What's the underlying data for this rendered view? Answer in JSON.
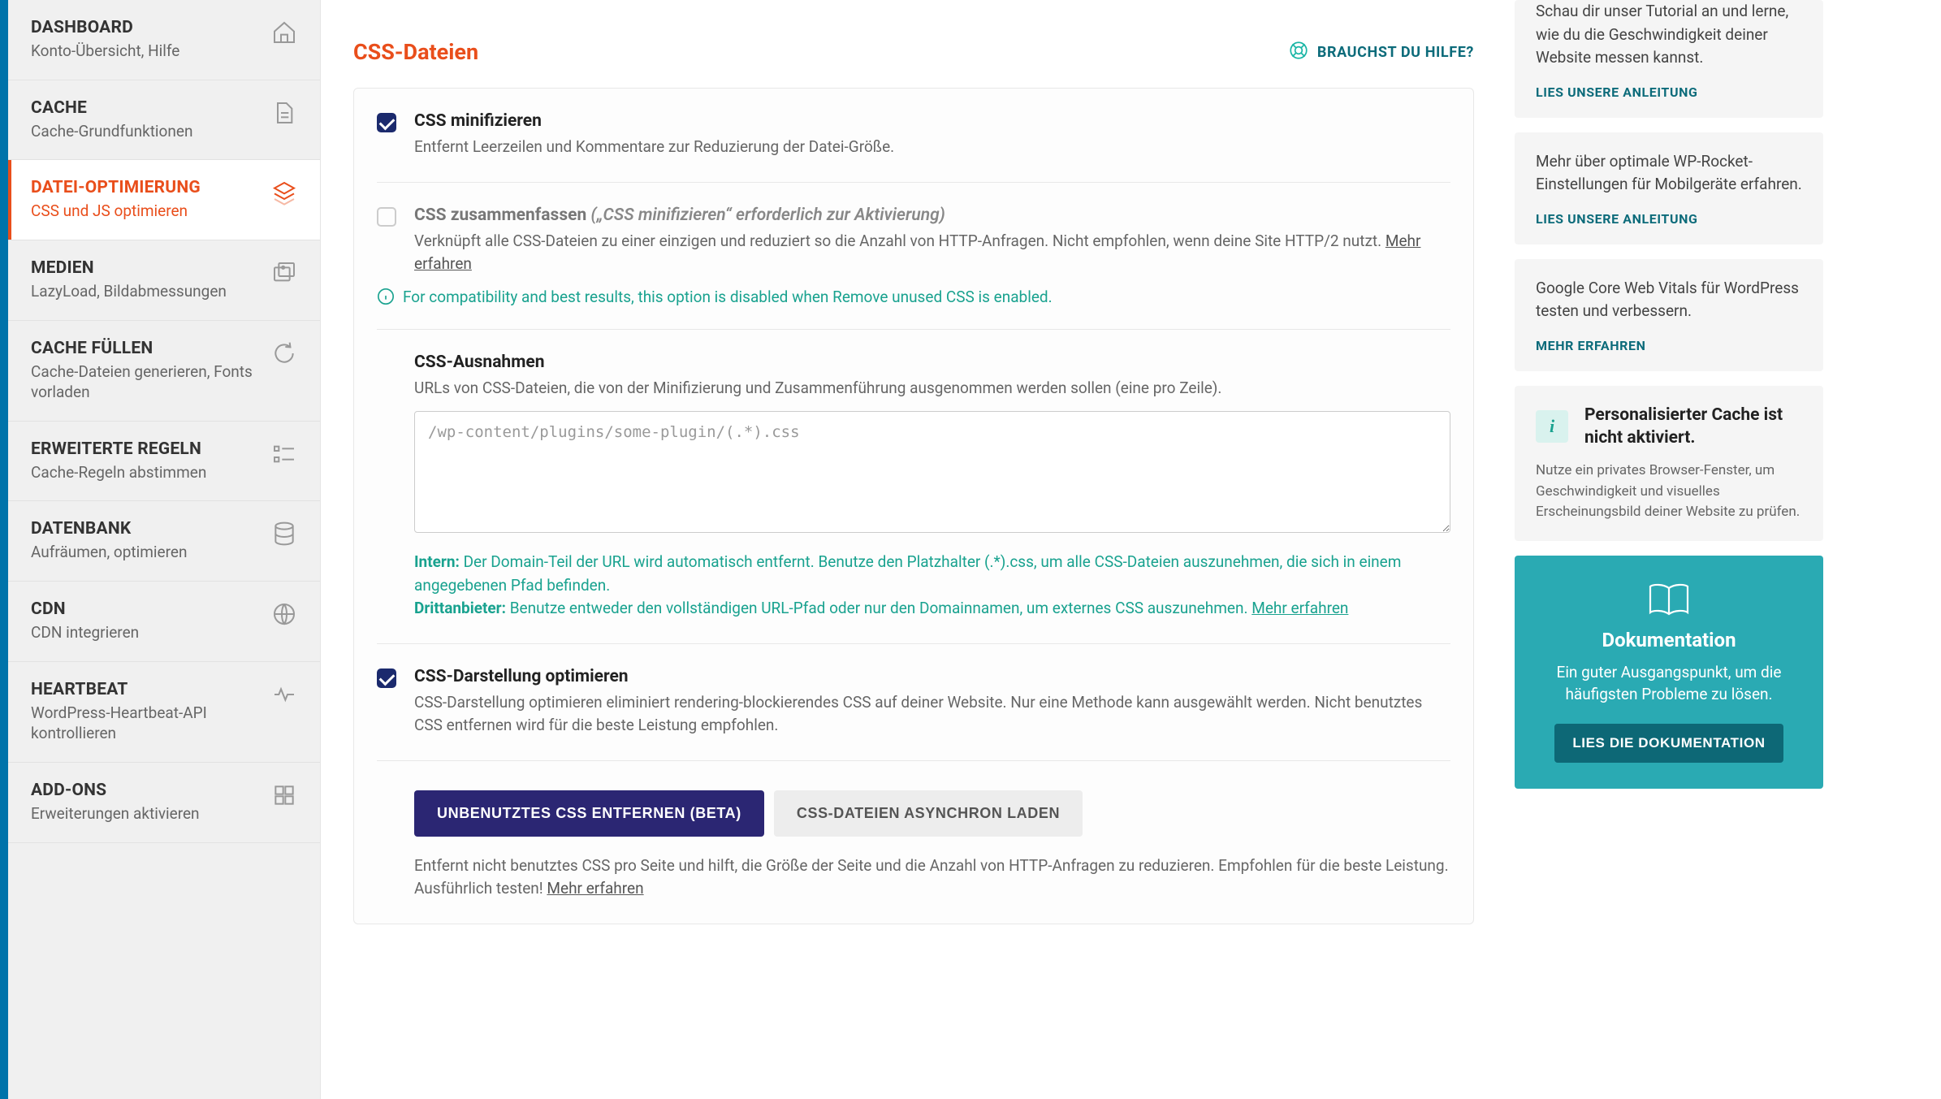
{
  "sidebar": [
    {
      "title": "DASHBOARD",
      "sub": "Konto-Übersicht, Hilfe",
      "icon": "house"
    },
    {
      "title": "CACHE",
      "sub": "Cache-Grundfunktionen",
      "icon": "file"
    },
    {
      "title": "DATEI-OPTIMIERUNG",
      "sub": "CSS und JS optimieren",
      "icon": "stack",
      "active": true
    },
    {
      "title": "MEDIEN",
      "sub": "LazyLoad, Bildabmessungen",
      "icon": "images"
    },
    {
      "title": "CACHE FÜLLEN",
      "sub": "Cache-Dateien generieren, Fonts vorladen",
      "icon": "refresh"
    },
    {
      "title": "ERWEITERTE REGELN",
      "sub": "Cache-Regeln abstimmen",
      "icon": "list"
    },
    {
      "title": "DATENBANK",
      "sub": "Aufräumen, optimieren",
      "icon": "db"
    },
    {
      "title": "CDN",
      "sub": "CDN integrieren",
      "icon": "globe"
    },
    {
      "title": "HEARTBEAT",
      "sub": "WordPress-Heartbeat-API kontrollieren",
      "icon": "heart"
    },
    {
      "title": "ADD-ONS",
      "sub": "Erweiterungen aktivieren",
      "icon": "cubes"
    }
  ],
  "section_title": "CSS-Dateien",
  "help_label": "BRAUCHST DU HILFE?",
  "minify": {
    "label": "CSS minifizieren",
    "desc": "Entfernt Leerzeilen und Kommentare zur Reduzierung der Datei-Größe.",
    "checked": true
  },
  "combine": {
    "label": "CSS zusammenfassen",
    "em": "(„CSS minifizieren“ erforderlich zur Aktivierung)",
    "desc": "Verknüpft alle CSS-Dateien zu einer einzigen und reduziert so die Anzahl von HTTP-Anfragen. Nicht empfohlen, wenn deine Site HTTP/2 nutzt.",
    "learn_more": "Mehr erfahren",
    "note": "For compatibility and best results, this option is disabled when Remove unused CSS is enabled."
  },
  "exclusions": {
    "title": "CSS-Ausnahmen",
    "desc": "URLs von CSS-Dateien, die von der Minifizierung und Zusammenführung ausgenommen werden sollen (eine pro Zeile).",
    "placeholder": "/wp-content/plugins/some-plugin/(.*).css",
    "hint_intern_label": "Intern:",
    "hint_intern": "Der Domain-Teil der URL wird automatisch entfernt. Benutze den Platzhalter (.*).css, um alle CSS-Dateien auszunehmen, die sich in einem angegebenen Pfad befinden.",
    "hint_dritt_label": "Drittanbieter:",
    "hint_dritt": "Benutze entweder den vollständigen URL-Pfad oder nur den Domainnamen, um externes CSS auszunehmen.",
    "learn_more": "Mehr erfahren"
  },
  "optimize": {
    "label": "CSS-Darstellung optimieren",
    "desc": "CSS-Darstellung optimieren eliminiert rendering-blockierendes CSS auf deiner Website. Nur eine Methode kann ausgewählt werden. Nicht benutztes CSS entfernen wird für die beste Leistung empfohlen.",
    "checked": true,
    "btn_primary": "UNBENUTZTES CSS ENTFERNEN (BETA)",
    "btn_secondary": "CSS-DATEIEN ASYNCHRON LADEN",
    "sub_desc": "Entfernt nicht benutztes CSS pro Seite und hilft, die Größe der Seite und die Anzahl von HTTP-Anfragen zu reduzieren. Empfohlen für die beste Leistung. Ausführlich testen!",
    "learn_more": "Mehr erfahren"
  },
  "cards": [
    {
      "text": "Schau dir unser Tutorial an und lerne, wie du die Geschwindigkeit deiner Website messen kannst.",
      "link": "LIES UNSERE ANLEITUNG"
    },
    {
      "text": "Mehr über optimale WP-Rocket-Einstellungen für Mobilgeräte erfahren.",
      "link": "LIES UNSERE ANLEITUNG"
    },
    {
      "text": "Google Core Web Vitals für WordPress testen und verbessern.",
      "link": "MEHR ERFAHREN"
    }
  ],
  "info_card": {
    "title": "Personalisierter Cache ist nicht aktiviert.",
    "desc": "Nutze ein privates Browser-Fenster, um Geschwindigkeit und visuelles Erscheinungsbild deiner Website zu prüfen."
  },
  "doc_card": {
    "title": "Dokumentation",
    "desc": "Ein guter Ausgangspunkt, um die häufigsten Probleme zu lösen.",
    "btn": "LIES DIE DOKUMENTATION"
  }
}
